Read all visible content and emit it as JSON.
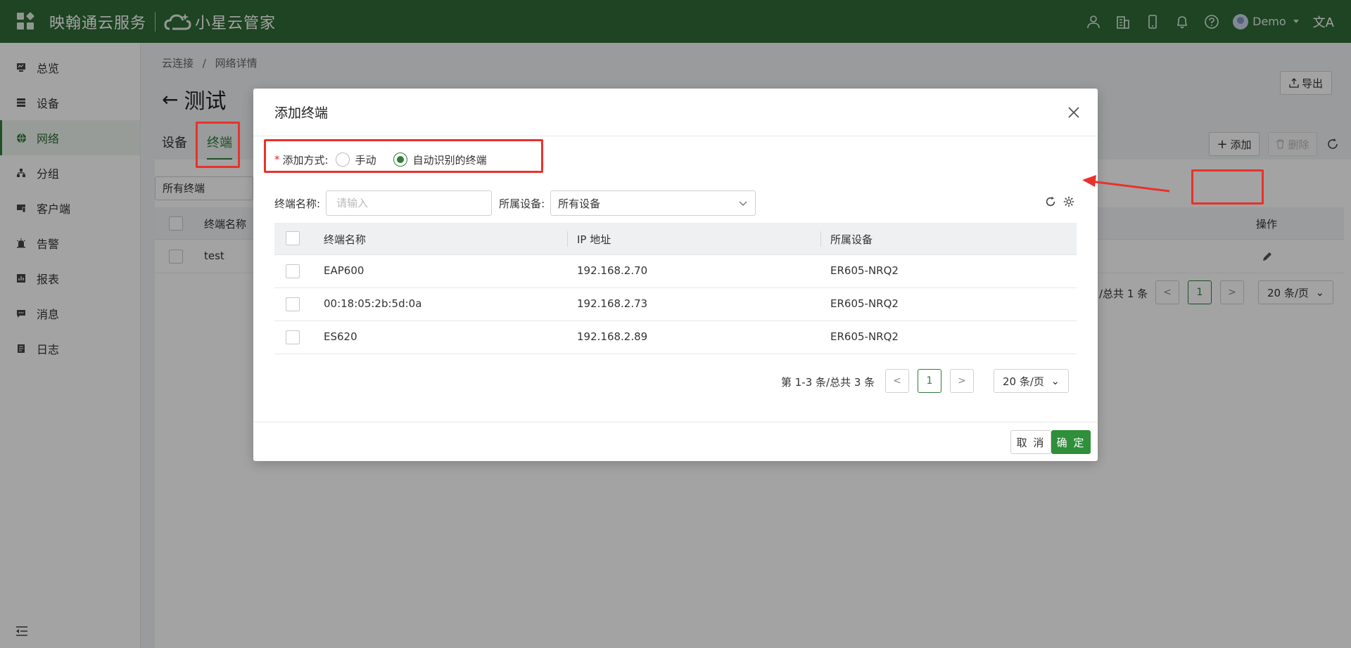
{
  "header": {
    "brand_name": "映翰通云服务",
    "product_name": "小星云管家",
    "user_name": "Demo",
    "lang_glyph": "文A",
    "icons": [
      "user-group-icon",
      "building-icon",
      "mobile-icon",
      "bell-icon",
      "help-icon"
    ]
  },
  "sidebar": {
    "items": [
      {
        "label": "总览",
        "icon": "monitor-icon"
      },
      {
        "label": "设备",
        "icon": "server-icon"
      },
      {
        "label": "网络",
        "icon": "globe-icon",
        "active": true
      },
      {
        "label": "分组",
        "icon": "cluster-icon"
      },
      {
        "label": "客户端",
        "icon": "client-icon"
      },
      {
        "label": "告警",
        "icon": "alarm-icon"
      },
      {
        "label": "报表",
        "icon": "report-icon"
      },
      {
        "label": "消息",
        "icon": "message-icon"
      },
      {
        "label": "日志",
        "icon": "log-icon"
      }
    ]
  },
  "page": {
    "breadcrumb_root": "云连接",
    "breadcrumb_sep": "/",
    "breadcrumb_current": "网络详情",
    "title": "测试",
    "export_label": "导出",
    "tabs": [
      {
        "label": "设备"
      },
      {
        "label": "终端",
        "active": true
      }
    ],
    "filter_value": "所有终端",
    "add_label": "添加",
    "delete_label": "删除",
    "table_header_name": "终端名称",
    "table_header_action": "操作",
    "row1_name": "test",
    "pager_text": "/总共 1 条",
    "pager_page": "1",
    "pager_size": "20 条/页"
  },
  "modal": {
    "title": "添加终端",
    "add_mode_label": "添加方式:",
    "option_manual": "手动",
    "option_auto": "自动识别的终端",
    "name_filter_label": "终端名称:",
    "name_placeholder": "请输入",
    "device_filter_label": "所属设备:",
    "device_filter_value": "所有设备",
    "columns": [
      "终端名称",
      "IP 地址",
      "所属设备"
    ],
    "rows": [
      {
        "name": "EAP600",
        "ip": "192.168.2.70",
        "device": "ER605-NRQ2"
      },
      {
        "name": "00:18:05:2b:5d:0a",
        "ip": "192.168.2.73",
        "device": "ER605-NRQ2"
      },
      {
        "name": "ES620",
        "ip": "192.168.2.89",
        "device": "ER605-NRQ2"
      }
    ],
    "pager_text": "第 1-3 条/总共 3 条",
    "pager_page": "1",
    "pager_size": "20 条/页",
    "cancel_label": "取 消",
    "ok_label": "确 定"
  },
  "colors": {
    "header_bg": "#2f6b37",
    "accent": "#2f7d3a",
    "annotation": "#e8322b"
  }
}
